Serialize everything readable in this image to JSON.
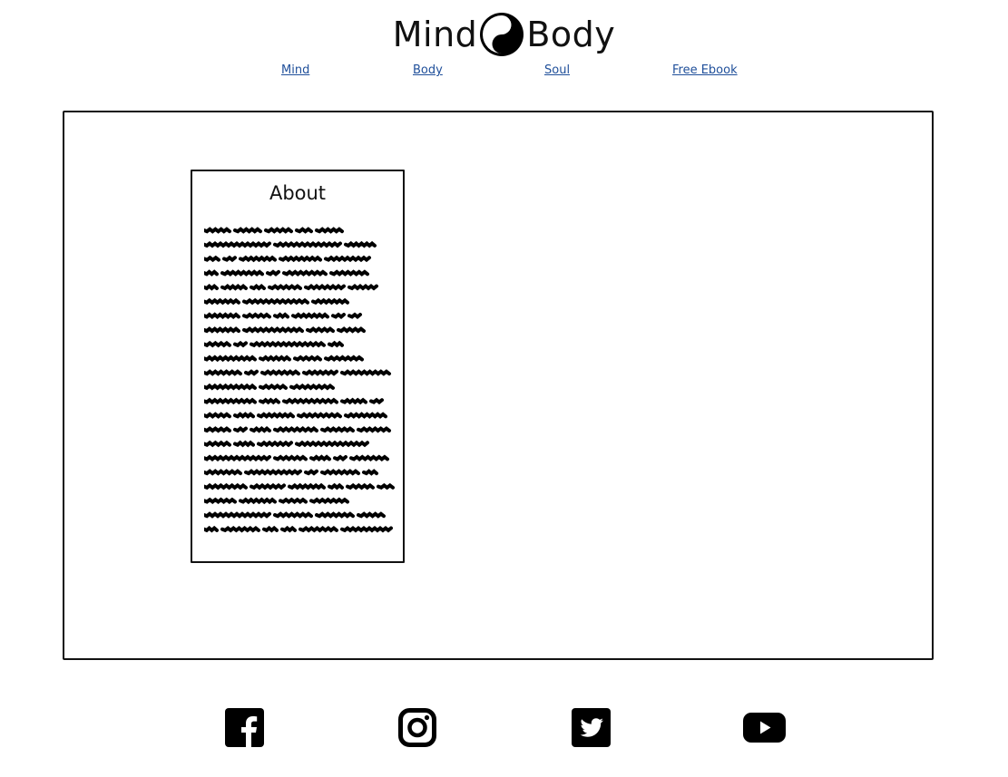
{
  "header": {
    "logo_left": "Mind",
    "logo_right": "Body",
    "logo_icon": "yin-yang-icon"
  },
  "nav": {
    "items": [
      {
        "label": "Mind"
      },
      {
        "label": "Body"
      },
      {
        "label": "Soul"
      },
      {
        "label": "Free Ebook"
      }
    ]
  },
  "about": {
    "title": "About",
    "body_text": "placeholder-scribble"
  },
  "footer": {
    "social": [
      {
        "name": "facebook-icon"
      },
      {
        "name": "instagram-icon"
      },
      {
        "name": "twitter-icon"
      },
      {
        "name": "youtube-icon"
      }
    ]
  },
  "colors": {
    "link": "#1f4f9a",
    "ink": "#111111"
  }
}
